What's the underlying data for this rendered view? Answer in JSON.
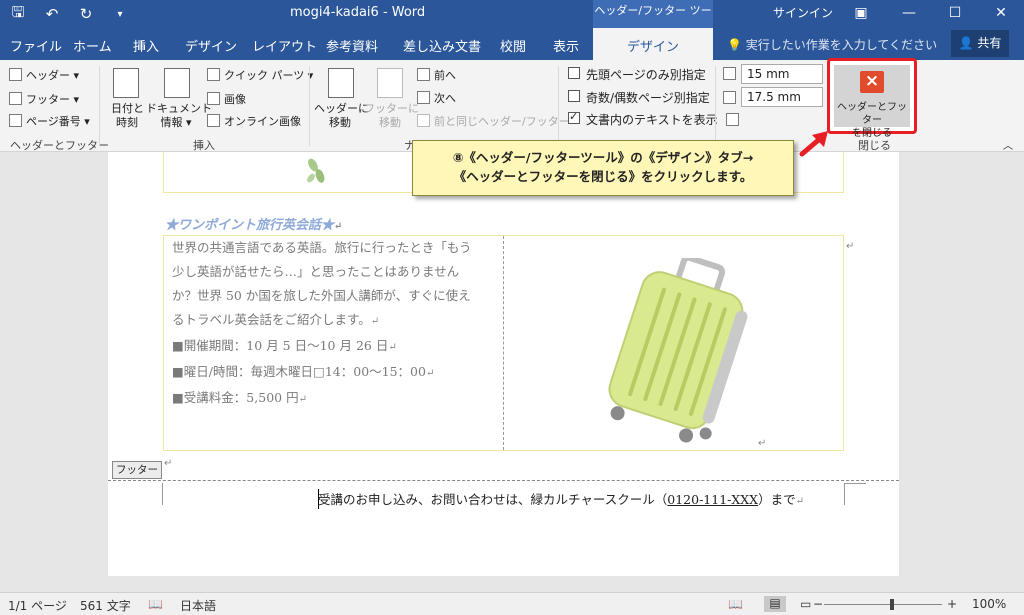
{
  "titlebar": {
    "qat": {
      "save_icon": "save-icon",
      "undo_icon": "undo-icon",
      "redo_icon": "redo-icon",
      "customize_icon": "qat-customize-icon"
    },
    "doc_title": "mogi4-kadai6 - Word",
    "context_title": "ヘッダー/フッター ツール",
    "signin": "サインイン",
    "window_buttons": {
      "ribbon_options": "▣",
      "minimize": "—",
      "maximize": "☐",
      "close": "✕"
    }
  },
  "tabs": [
    {
      "label": "ファイル"
    },
    {
      "label": "ホーム"
    },
    {
      "label": "挿入"
    },
    {
      "label": "デザイン"
    },
    {
      "label": "レイアウト"
    },
    {
      "label": "参考資料"
    },
    {
      "label": "差し込み文書"
    },
    {
      "label": "校閲"
    },
    {
      "label": "表示"
    },
    {
      "label": "デザイン",
      "active": true
    }
  ],
  "tellme": "実行したい作業を入力してください",
  "share": "共有",
  "ribbon": {
    "hf_group": {
      "header": "ヘッダー",
      "footer": "フッター",
      "page_number": "ページ番号",
      "label": "ヘッダーとフッター"
    },
    "insert_group": {
      "datetime_line1": "日付と",
      "datetime_line2": "時刻",
      "docinfo_line1": "ドキュメント",
      "docinfo_line2": "情報",
      "quick_parts": "クイック パーツ",
      "picture": "画像",
      "online_picture": "オンライン画像",
      "label": "挿入"
    },
    "nav_group": {
      "goto_header_line1": "ヘッダーに",
      "goto_header_line2": "移動",
      "goto_footer_line1": "フッターに",
      "goto_footer_line2": "移動",
      "previous": "前へ",
      "next": "次へ",
      "link_previous": "前と同じヘッダー/フッター",
      "label_partial": "ナ"
    },
    "options_group": {
      "different_first": "先頭ページのみ別指定",
      "different_odd_even": "奇数/偶数ページ別指定",
      "show_doc_text": "文書内のテキストを表示",
      "different_first_checked": false,
      "different_odd_even_checked": false,
      "show_doc_text_checked": true
    },
    "position_group": {
      "header_top": "15 mm",
      "footer_bottom": "17.5 mm"
    },
    "close_group": {
      "close_line1": "ヘッダーとフッター",
      "close_line2": "を閉じる",
      "label": "閉じる"
    }
  },
  "callout": {
    "line1": "⑧《ヘッダー/フッターツール》の《デザイン》タブ→",
    "line2": "《ヘッダーとフッターを閉じる》をクリックします。"
  },
  "document": {
    "heading": "★ワンポイント旅行英会話★",
    "paragraphs": [
      "世界の共通言語である英語。旅行に行ったとき「もう",
      "少し英語が話せたら…」と思ったことはありません",
      "か？世界 50 か国を旅した外国人講師が、すぐに使え",
      "るトラベル英会話をご紹介します。"
    ],
    "details": [
      "■開催期間：10 月 5 日〜10 月 26 日",
      "■曜日/時間：毎週木曜日□14：00〜15：00",
      "■受講料金：5,500 円"
    ],
    "footer_tag": "フッター",
    "footer_text_before": "受講のお申し込み、お問い合わせは、緑カルチャースクール（",
    "footer_phone": "0120-111-XXX",
    "footer_text_after": "）まで"
  },
  "statusbar": {
    "page": "1/1 ページ",
    "words": "561 文字",
    "language": "日本語",
    "zoom": "100%",
    "zoom_minus": "−",
    "zoom_plus": "+"
  },
  "colors": {
    "title_blue": "#2b579a",
    "close_red": "#e81e25",
    "callout_yellow": "#fff7b8",
    "heading_blue": "#8faad9",
    "suitcase_green": "#d8e98f"
  }
}
